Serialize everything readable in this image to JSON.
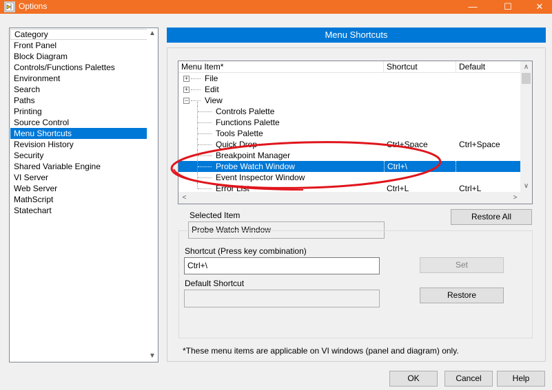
{
  "window": {
    "title": "Options",
    "icon": "labview-icon",
    "controls": {
      "minimize": "—",
      "maximize": "☐",
      "close": "✕"
    }
  },
  "category_list": {
    "header": "Category",
    "items": [
      "Front Panel",
      "Block Diagram",
      "Controls/Functions Palettes",
      "Environment",
      "Search",
      "Paths",
      "Printing",
      "Source Control",
      "Menu Shortcuts",
      "Revision History",
      "Security",
      "Shared Variable Engine",
      "VI Server",
      "Web Server",
      "MathScript",
      "Statechart"
    ],
    "selected": "Menu Shortcuts"
  },
  "panel": {
    "title": "Menu Shortcuts",
    "table": {
      "headers": {
        "item": "Menu Item*",
        "shortcut": "Shortcut",
        "default": "Default"
      },
      "rows": [
        {
          "item": "File",
          "shortcut": "",
          "default": "",
          "level": 0,
          "expander": "+"
        },
        {
          "item": "Edit",
          "shortcut": "",
          "default": "",
          "level": 0,
          "expander": "+"
        },
        {
          "item": "View",
          "shortcut": "",
          "default": "",
          "level": 0,
          "expander": "−"
        },
        {
          "item": "Controls Palette",
          "shortcut": "",
          "default": "",
          "level": 1
        },
        {
          "item": "Functions Palette",
          "shortcut": "",
          "default": "",
          "level": 1
        },
        {
          "item": "Tools Palette",
          "shortcut": "",
          "default": "",
          "level": 1
        },
        {
          "item": "Quick Drop",
          "shortcut": "Ctrl+Space",
          "default": "Ctrl+Space",
          "level": 1
        },
        {
          "item": "Breakpoint Manager",
          "shortcut": "",
          "default": "",
          "level": 1
        },
        {
          "item": "Probe Watch Window",
          "shortcut": "Ctrl+\\",
          "default": "",
          "level": 1,
          "selected": true
        },
        {
          "item": "Event Inspector Window",
          "shortcut": "",
          "default": "",
          "level": 1
        },
        {
          "item": "Error List",
          "shortcut": "Ctrl+L",
          "default": "Ctrl+L",
          "level": 1
        }
      ]
    },
    "restore_all_label": "Restore All",
    "selected_item_label": "Selected Item",
    "selected_item_value": "Probe Watch Window",
    "shortcut_label": "Shortcut (Press key combination)",
    "shortcut_value": "Ctrl+\\",
    "set_label": "Set",
    "default_shortcut_label": "Default Shortcut",
    "default_shortcut_value": "",
    "restore_label": "Restore",
    "footnote": "*These menu items are applicable on VI windows (panel and diagram) only."
  },
  "footer": {
    "ok_label": "OK",
    "cancel_label": "Cancel",
    "help_label": "Help"
  },
  "colors": {
    "titlebar": "#f27024",
    "selection": "#0078d7",
    "annotation": "#e0151c"
  }
}
